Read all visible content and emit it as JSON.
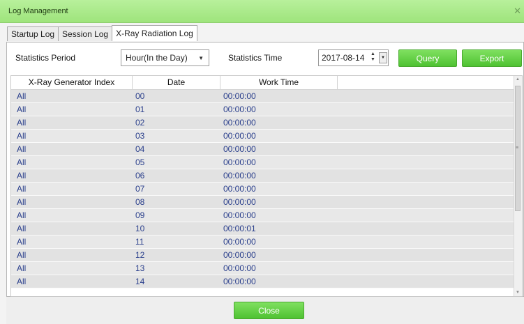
{
  "window": {
    "title": "Log Management",
    "close_glyph": "✕"
  },
  "tabs": [
    {
      "label": "Startup Log",
      "active": false
    },
    {
      "label": "Session Log",
      "active": false
    },
    {
      "label": "X-Ray Radiation Log",
      "active": true
    }
  ],
  "filters": {
    "period_label": "Statistics Period",
    "period_value": "Hour(In the Day)",
    "time_label": "Statistics Time",
    "time_value": "2017-08-14"
  },
  "buttons": {
    "query": "Query",
    "export": "Export",
    "close": "Close"
  },
  "table": {
    "columns": [
      "X-Ray Generator Index",
      "Date",
      "Work Time"
    ],
    "rows": [
      [
        "All",
        "00",
        "00:00:00"
      ],
      [
        "All",
        "01",
        "00:00:00"
      ],
      [
        "All",
        "02",
        "00:00:00"
      ],
      [
        "All",
        "03",
        "00:00:00"
      ],
      [
        "All",
        "04",
        "00:00:00"
      ],
      [
        "All",
        "05",
        "00:00:00"
      ],
      [
        "All",
        "06",
        "00:00:00"
      ],
      [
        "All",
        "07",
        "00:00:00"
      ],
      [
        "All",
        "08",
        "00:00:00"
      ],
      [
        "All",
        "09",
        "00:00:00"
      ],
      [
        "All",
        "10",
        "00:00:01"
      ],
      [
        "All",
        "11",
        "00:00:00"
      ],
      [
        "All",
        "12",
        "00:00:00"
      ],
      [
        "All",
        "13",
        "00:00:00"
      ],
      [
        "All",
        "14",
        "00:00:00"
      ]
    ]
  },
  "colors": {
    "accent_green": "#4fc232",
    "title_green": "#a8e88a",
    "cell_text": "#2a3f8c"
  }
}
